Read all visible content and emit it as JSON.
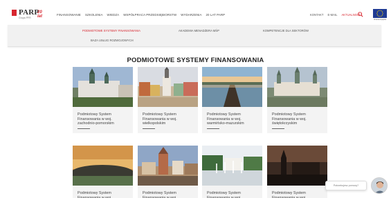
{
  "header": {
    "logo_name": "PARP",
    "logo_badge": "20 lat",
    "logo_sub": "Grupa PFR",
    "nav": [
      {
        "label": "Finansowanie"
      },
      {
        "label": "Szkolenia"
      },
      {
        "label": "Wiedza"
      },
      {
        "label": "Współpraca przedsiębiorstw"
      },
      {
        "label": "Wydarzenia"
      },
      {
        "label": "20 lat PARP"
      }
    ],
    "util": [
      {
        "label": "Kontakt"
      },
      {
        "label": "E-mail"
      },
      {
        "label": "Aktualności"
      }
    ],
    "eu_label": "Unia Europejska"
  },
  "subnav": {
    "items": [
      {
        "label": "Podmiotowe Systemy Finansowania",
        "active": true
      },
      {
        "label": "Akademia Menadżera MŚP",
        "active": false
      },
      {
        "label": "Kompetencje dla sektorów",
        "active": false
      },
      {
        "label": "Baza Usług Rozwojowych",
        "active": false
      }
    ]
  },
  "main": {
    "section_title": "PODMIOTOWE SYSTEMY FINANSOWANIA",
    "cards": [
      {
        "title": "Podmiotowy System Finansowania w woj. zachodnio-pomorskim",
        "image": "city-szczecin"
      },
      {
        "title": "Podmiotowy System Finansowania w woj. wielkopolskim",
        "image": "city-poznan"
      },
      {
        "title": "Podmiotowy System Finansowania w woj. warmińsko-mazurskim",
        "image": "lake-pier"
      },
      {
        "title": "Podmiotowy System Finansowania w woj. świętokrzyskim",
        "image": "city-kielce"
      },
      {
        "title": "Podmiotowy System Finansowania w woj. ...",
        "image": "sunset-field"
      },
      {
        "title": "Podmiotowy System Finansowania w woj. ...",
        "image": "city-torun"
      },
      {
        "title": "Podmiotowy System Finansowania w woj. ...",
        "image": "fountain-square"
      },
      {
        "title": "Podmiotowy System Finansowania w woj. ...",
        "image": "night-silhouette"
      }
    ]
  },
  "chat": {
    "prompt": "Potrzebujesz pomocy?"
  },
  "colors": {
    "accent": "#d7262f",
    "card_bg": "#f3f3f3",
    "subnav_bg": "#f1f1f1"
  }
}
